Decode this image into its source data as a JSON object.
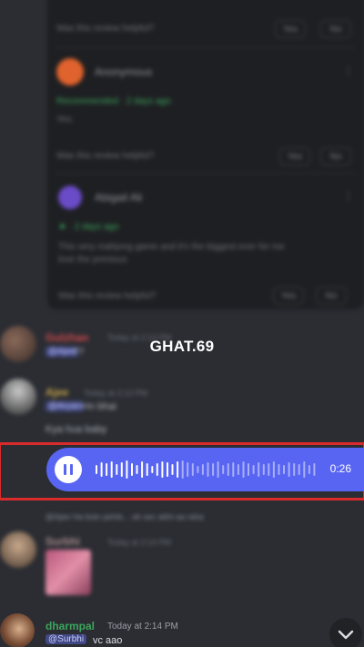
{
  "watermark": "GHAT.69",
  "review": {
    "top_label": "Was this review helpful?",
    "reviewer1": {
      "name": "Anonymous",
      "date": "Recommended · 2 days ago",
      "text": "Yes."
    },
    "prompt1": "Was this review helpful?",
    "reviewer2": {
      "name": "Abigail Ali",
      "date": "★ · 2 days ago",
      "text_line1": "This very mahjong game and it's the biggest ever for me",
      "text_line2": "love the previous"
    },
    "prompt2": "Was this review helpful?",
    "btn_yes": "Yes",
    "btn_no": "No"
  },
  "messages": [
    {
      "name": "Gulzhan",
      "time": "Today at 2:13 PM",
      "mention": "@Ajee",
      "text": "??"
    },
    {
      "name": "Ajee",
      "time": "Today at 2:13 PM",
      "mention": "@Aryan",
      "text_inline": "Hn bhai",
      "text": "Kya hua baby"
    },
    {
      "reply": "@Ajee  Ha bolo pehle... ek sec abhi aa raha",
      "name": "Surbhi",
      "time": "Today at 2:14 PM"
    }
  ],
  "voice_message": {
    "state": "paused",
    "duration": "0:26",
    "played_fraction": 0.38
  },
  "last_message": {
    "name": "dharmpal",
    "time": "Today at 2:14 PM",
    "mention": "@Surbhi",
    "text": "vc aao"
  },
  "colors": {
    "background": "#2b2d33",
    "voice_bubble": "#5865f2",
    "highlight": "#d92b2b",
    "username_green": "#3ba55c"
  }
}
